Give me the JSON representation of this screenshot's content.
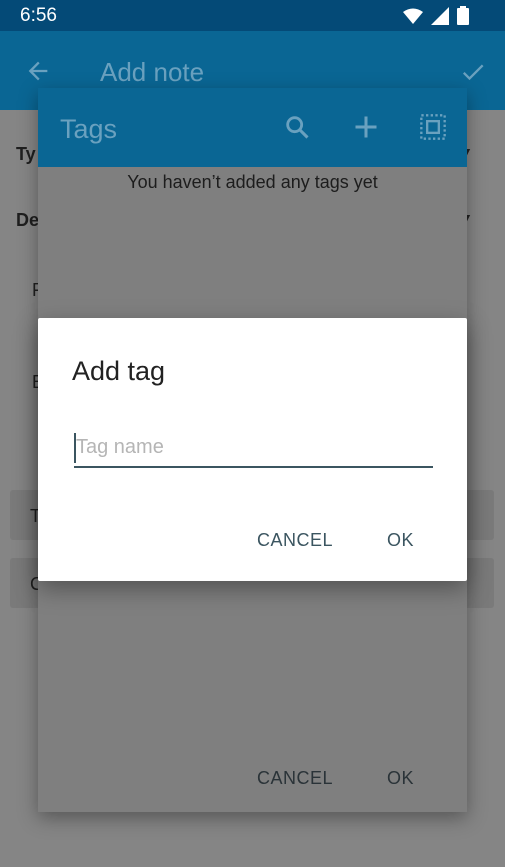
{
  "status_bar": {
    "time": "6:56"
  },
  "app_bar": {
    "title": "Add note"
  },
  "base_form": {
    "labels": [
      "Ty",
      "De"
    ],
    "fragments": [
      "F",
      "E",
      "T",
      "C"
    ]
  },
  "tags_dialog": {
    "title": "Tags",
    "empty_message": "You haven’t added any tags yet",
    "cancel_label": "CANCEL",
    "ok_label": "OK"
  },
  "add_tag_dialog": {
    "title": "Add tag",
    "input_placeholder": "Tag name",
    "input_value": "",
    "cancel_label": "CANCEL",
    "ok_label": "OK"
  },
  "colors": {
    "accent": "#0a6694",
    "status_bar": "#044a77",
    "button_text": "#3b5560"
  },
  "icons": [
    "wifi-icon",
    "signal-icon",
    "battery-icon",
    "back-arrow-icon",
    "check-icon",
    "search-icon",
    "add-icon",
    "select-all-icon"
  ]
}
